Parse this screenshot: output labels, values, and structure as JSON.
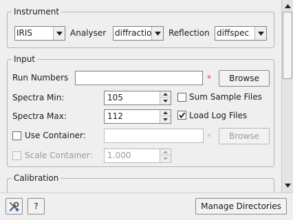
{
  "instrument_group": {
    "title": "Instrument",
    "instrument_value": "IRIS",
    "analyser_label": "Analyser",
    "analyser_value": "diffraction",
    "reflection_label": "Reflection",
    "reflection_value": "diffspec"
  },
  "input_group": {
    "title": "Input",
    "run_numbers_label": "Run Numbers",
    "run_numbers_value": "",
    "required_marker": "*",
    "browse_label": "Browse",
    "spectra_min_label": "Spectra Min:",
    "spectra_min_value": "105",
    "spectra_max_label": "Spectra Max:",
    "spectra_max_value": "112",
    "sum_sample_files_label": "Sum Sample Files",
    "sum_sample_files_checked": false,
    "load_log_files_label": "Load Log Files",
    "load_log_files_checked": true,
    "use_container_label": "Use Container:",
    "use_container_checked": false,
    "container_value": "",
    "container_required_marker": "*",
    "container_browse_label": "Browse",
    "scale_container_label": "Scale Container:",
    "scale_container_checked": false,
    "scale_container_value": "1.000"
  },
  "calibration_group": {
    "title": "Calibration"
  },
  "footer": {
    "help_label": "?",
    "manage_directories_label": "Manage Directories"
  },
  "icons": [
    "settings-tools-icon",
    "chevron-down-icon",
    "spin-up-icon",
    "spin-down-icon",
    "scroll-up-icon",
    "scroll-down-icon",
    "checkmark-icon"
  ]
}
